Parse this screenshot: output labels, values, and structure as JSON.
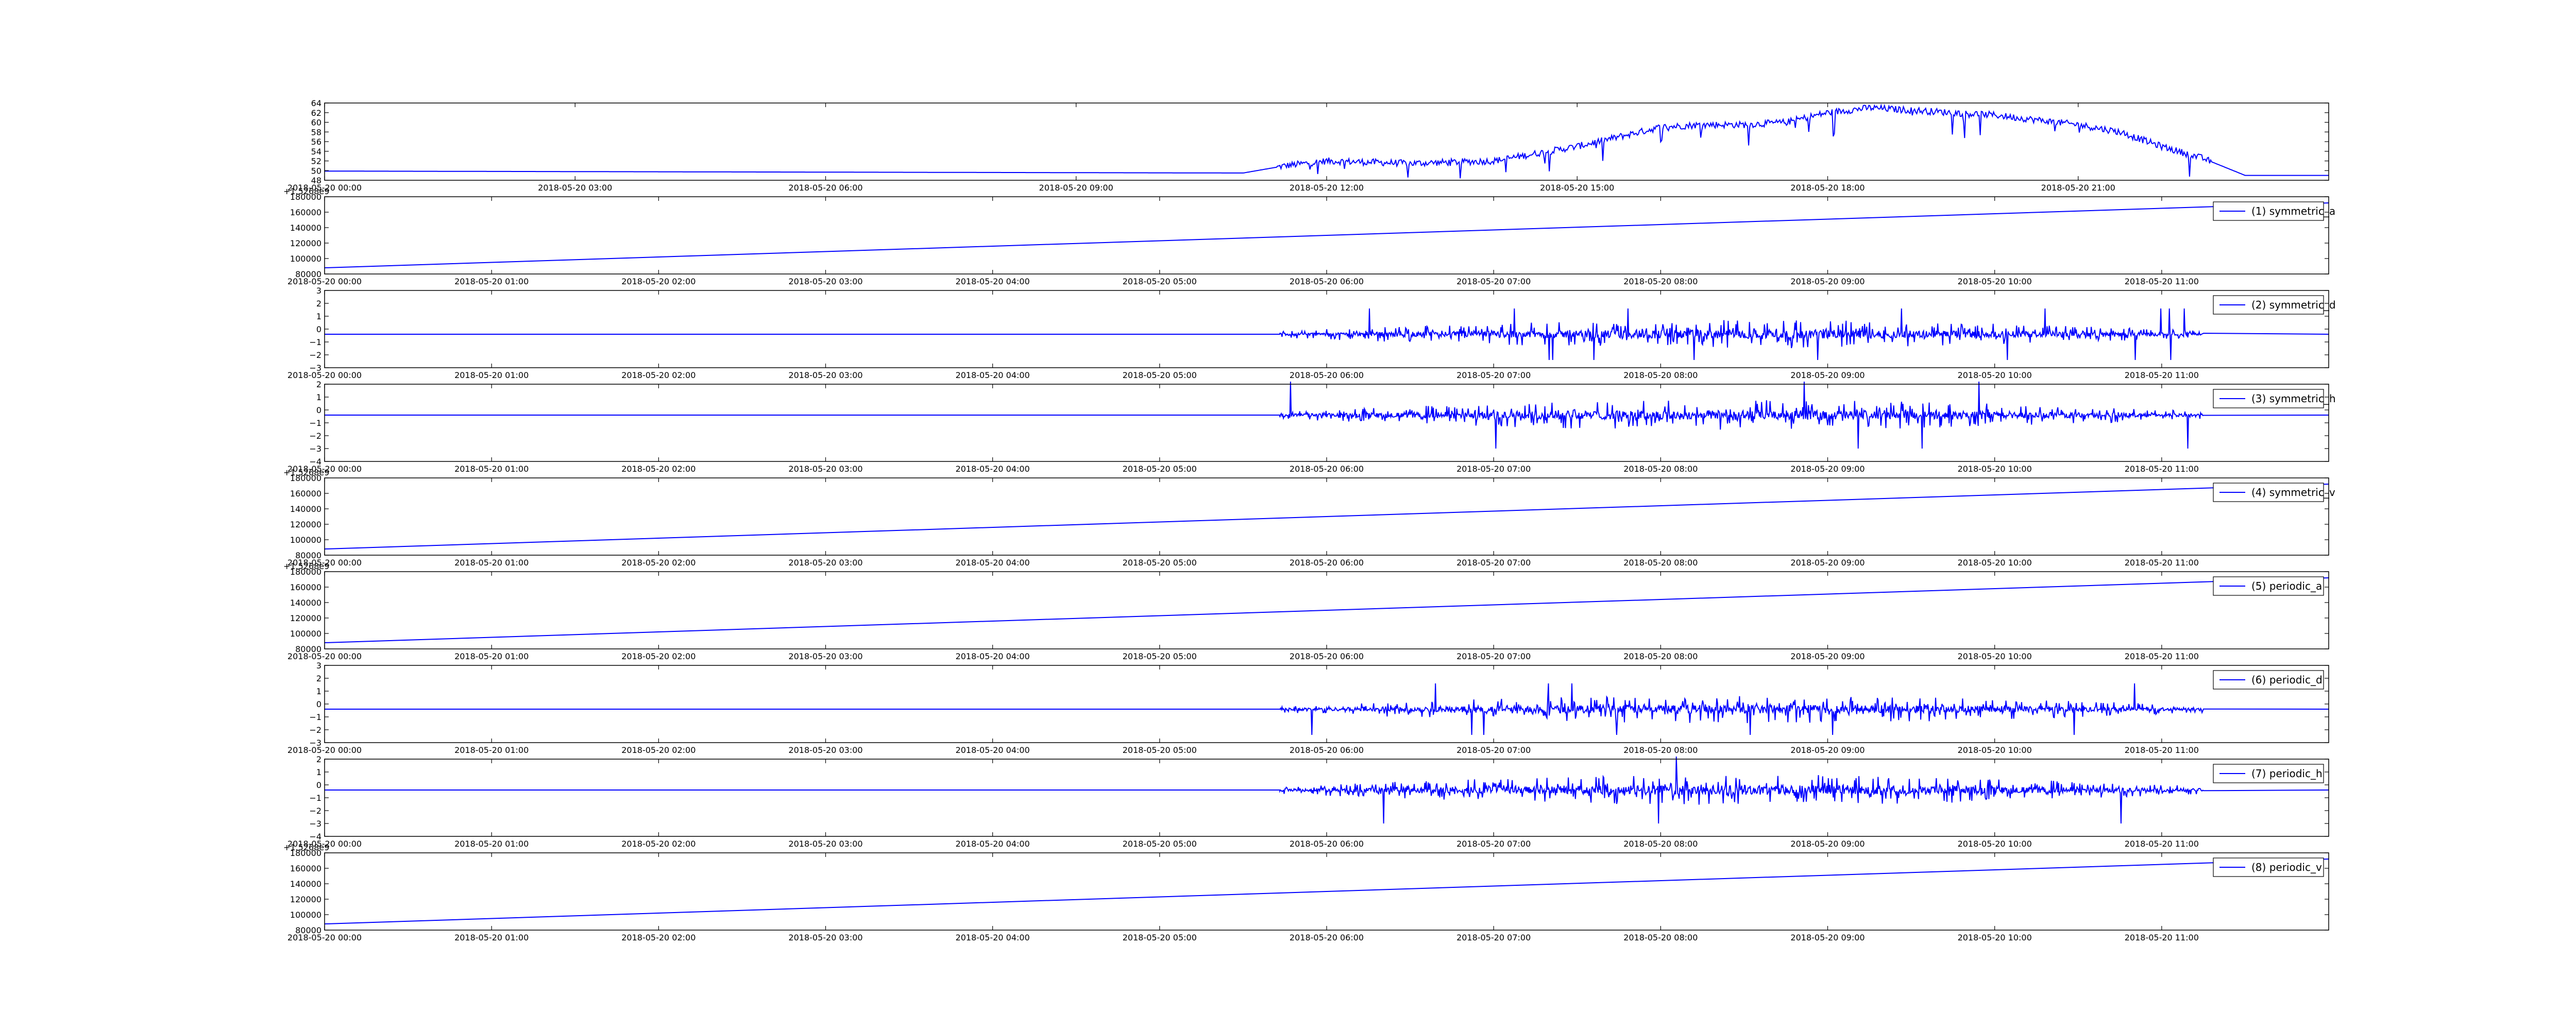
{
  "chart_data": [
    {
      "type": "line",
      "x_ticks": [
        "2018-05-20 00:00",
        "2018-05-20 03:00",
        "2018-05-20 06:00",
        "2018-05-20 09:00",
        "2018-05-20 12:00",
        "2018-05-20 15:00",
        "2018-05-20 18:00",
        "2018-05-20 21:00"
      ],
      "y_ticks": [
        "48",
        "50",
        "52",
        "54",
        "56",
        "58",
        "60",
        "62",
        "64"
      ],
      "ylim": [
        48,
        64
      ],
      "xlim": [
        0,
        24
      ],
      "offset_text": "",
      "legend": "",
      "series_color": "#0000ff",
      "series": {
        "pattern": "solar",
        "x": [
          0,
          11,
          11.5,
          12,
          13,
          14,
          14.5,
          15,
          15.5,
          16,
          16.5,
          17,
          17.5,
          18,
          18.5,
          19,
          19.5,
          20,
          20.5,
          21,
          21.5,
          22,
          22.5,
          23,
          24
        ],
        "y": [
          49.9,
          49.5,
          51,
          52,
          51.5,
          52,
          53.5,
          55,
          57,
          59,
          59.5,
          59.5,
          60,
          62,
          63,
          62.5,
          62,
          61.5,
          60.5,
          59.5,
          58,
          55,
          52.5,
          49,
          49
        ]
      }
    },
    {
      "type": "line",
      "x_ticks": [
        "2018-05-20 00:00",
        "2018-05-20 01:00",
        "2018-05-20 02:00",
        "2018-05-20 03:00",
        "2018-05-20 04:00",
        "2018-05-20 05:00",
        "2018-05-20 06:00",
        "2018-05-20 07:00",
        "2018-05-20 08:00",
        "2018-05-20 09:00",
        "2018-05-20 10:00",
        "2018-05-20 11:00"
      ],
      "y_ticks": [
        "80000",
        "100000",
        "120000",
        "140000",
        "160000",
        "180000"
      ],
      "ylim": [
        80000,
        180000
      ],
      "xlim": [
        0,
        12
      ],
      "offset_text": "+1.5268e9",
      "legend": "(1) symmetric_a",
      "series_color": "#0000ff",
      "series": {
        "pattern": "ramp",
        "x": [
          0,
          12
        ],
        "y": [
          88000,
          172000
        ]
      }
    },
    {
      "type": "line",
      "x_ticks": [
        "2018-05-20 00:00",
        "2018-05-20 01:00",
        "2018-05-20 02:00",
        "2018-05-20 03:00",
        "2018-05-20 04:00",
        "2018-05-20 05:00",
        "2018-05-20 06:00",
        "2018-05-20 07:00",
        "2018-05-20 08:00",
        "2018-05-20 09:00",
        "2018-05-20 10:00",
        "2018-05-20 11:00"
      ],
      "y_ticks": [
        "−3",
        "−2",
        "−1",
        "0",
        "1",
        "2",
        "3"
      ],
      "ylim": [
        -3,
        3
      ],
      "xlim": [
        0,
        12
      ],
      "offset_text": "",
      "legend": "(2) symmetric_d",
      "series_color": "#0000ff",
      "series": {
        "pattern": "noise",
        "baseline": -0.4,
        "start": 5.72,
        "end": 11.25,
        "amplitude": 1.1,
        "spike": 2.0
      }
    },
    {
      "type": "line",
      "x_ticks": [
        "2018-05-20 00:00",
        "2018-05-20 01:00",
        "2018-05-20 02:00",
        "2018-05-20 03:00",
        "2018-05-20 04:00",
        "2018-05-20 05:00",
        "2018-05-20 06:00",
        "2018-05-20 07:00",
        "2018-05-20 08:00",
        "2018-05-20 09:00",
        "2018-05-20 10:00",
        "2018-05-20 11:00"
      ],
      "y_ticks": [
        "−4",
        "−3",
        "−2",
        "−1",
        "0",
        "1",
        "2"
      ],
      "ylim": [
        -4,
        2
      ],
      "xlim": [
        0,
        12
      ],
      "offset_text": "",
      "legend": "(3) symmetric_h",
      "series_color": "#0000ff",
      "series": {
        "pattern": "noise",
        "baseline": -0.4,
        "start": 5.72,
        "end": 11.25,
        "amplitude": 1.2,
        "spike": 2.6
      }
    },
    {
      "type": "line",
      "x_ticks": [
        "2018-05-20 00:00",
        "2018-05-20 01:00",
        "2018-05-20 02:00",
        "2018-05-20 03:00",
        "2018-05-20 04:00",
        "2018-05-20 05:00",
        "2018-05-20 06:00",
        "2018-05-20 07:00",
        "2018-05-20 08:00",
        "2018-05-20 09:00",
        "2018-05-20 10:00",
        "2018-05-20 11:00"
      ],
      "y_ticks": [
        "80000",
        "100000",
        "120000",
        "140000",
        "160000",
        "180000"
      ],
      "ylim": [
        80000,
        180000
      ],
      "xlim": [
        0,
        12
      ],
      "offset_text": "+1.5268e9",
      "legend": "(4) symmetric_v",
      "series_color": "#0000ff",
      "series": {
        "pattern": "ramp",
        "x": [
          0,
          12
        ],
        "y": [
          88000,
          172000
        ]
      }
    },
    {
      "type": "line",
      "x_ticks": [
        "2018-05-20 00:00",
        "2018-05-20 01:00",
        "2018-05-20 02:00",
        "2018-05-20 03:00",
        "2018-05-20 04:00",
        "2018-05-20 05:00",
        "2018-05-20 06:00",
        "2018-05-20 07:00",
        "2018-05-20 08:00",
        "2018-05-20 09:00",
        "2018-05-20 10:00",
        "2018-05-20 11:00"
      ],
      "y_ticks": [
        "80000",
        "100000",
        "120000",
        "140000",
        "160000",
        "180000"
      ],
      "ylim": [
        80000,
        180000
      ],
      "xlim": [
        0,
        12
      ],
      "offset_text": "+1.5268e9",
      "legend": "(5) periodic_a",
      "series_color": "#0000ff",
      "series": {
        "pattern": "ramp",
        "x": [
          0,
          12
        ],
        "y": [
          88000,
          172000
        ]
      }
    },
    {
      "type": "line",
      "x_ticks": [
        "2018-05-20 00:00",
        "2018-05-20 01:00",
        "2018-05-20 02:00",
        "2018-05-20 03:00",
        "2018-05-20 04:00",
        "2018-05-20 05:00",
        "2018-05-20 06:00",
        "2018-05-20 07:00",
        "2018-05-20 08:00",
        "2018-05-20 09:00",
        "2018-05-20 10:00",
        "2018-05-20 11:00"
      ],
      "y_ticks": [
        "−3",
        "−2",
        "−1",
        "0",
        "1",
        "2",
        "3"
      ],
      "ylim": [
        -3,
        3
      ],
      "xlim": [
        0,
        12
      ],
      "offset_text": "",
      "legend": "(6) periodic_d",
      "series_color": "#0000ff",
      "series": {
        "pattern": "noise",
        "baseline": -0.4,
        "start": 5.72,
        "end": 11.25,
        "amplitude": 1.1,
        "spike": 2.0
      }
    },
    {
      "type": "line",
      "x_ticks": [
        "2018-05-20 00:00",
        "2018-05-20 01:00",
        "2018-05-20 02:00",
        "2018-05-20 03:00",
        "2018-05-20 04:00",
        "2018-05-20 05:00",
        "2018-05-20 06:00",
        "2018-05-20 07:00",
        "2018-05-20 08:00",
        "2018-05-20 09:00",
        "2018-05-20 10:00",
        "2018-05-20 11:00"
      ],
      "y_ticks": [
        "−4",
        "−3",
        "−2",
        "−1",
        "0",
        "1",
        "2"
      ],
      "ylim": [
        -4,
        2
      ],
      "xlim": [
        0,
        12
      ],
      "offset_text": "",
      "legend": "(7) periodic_h",
      "series_color": "#0000ff",
      "series": {
        "pattern": "noise",
        "baseline": -0.4,
        "start": 5.72,
        "end": 11.25,
        "amplitude": 1.2,
        "spike": 2.6
      }
    },
    {
      "type": "line",
      "x_ticks": [
        "2018-05-20 00:00",
        "2018-05-20 01:00",
        "2018-05-20 02:00",
        "2018-05-20 03:00",
        "2018-05-20 04:00",
        "2018-05-20 05:00",
        "2018-05-20 06:00",
        "2018-05-20 07:00",
        "2018-05-20 08:00",
        "2018-05-20 09:00",
        "2018-05-20 10:00",
        "2018-05-20 11:00"
      ],
      "y_ticks": [
        "80000",
        "100000",
        "120000",
        "140000",
        "160000",
        "180000"
      ],
      "ylim": [
        80000,
        180000
      ],
      "xlim": [
        0,
        12
      ],
      "offset_text": "+1.5268e9",
      "legend": "(8) periodic_v",
      "series_color": "#0000ff",
      "series": {
        "pattern": "ramp",
        "x": [
          0,
          12
        ],
        "y": [
          88000,
          172000
        ]
      }
    }
  ]
}
